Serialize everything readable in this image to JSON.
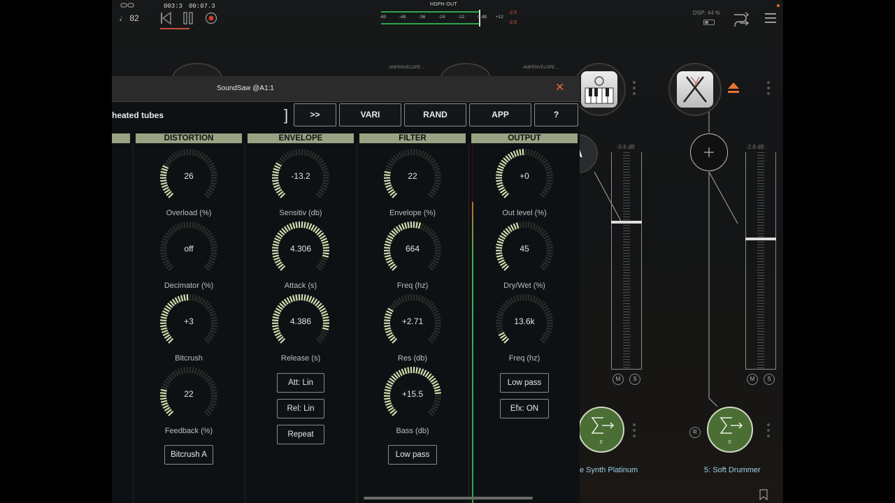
{
  "topbar": {
    "tempo": "♩ 82",
    "bars": "003:3",
    "time": "00:07.3",
    "meter_title": "HDPH OUT",
    "meter_scale": [
      "-60",
      "-48",
      "-36",
      "-24",
      "-12",
      "0 dB",
      "+12"
    ],
    "peak_top": "-2.5",
    "peak_bottom": "-2.6",
    "dsp": "DSP: 44 %"
  },
  "mixer": {
    "amp_env_1": "AMPENVELOPE…",
    "amp_env_2": "AMPENVELOPE…",
    "fader1_db": "-0.6 dB",
    "fader2_db": "-2.8 dB",
    "mute": "M",
    "solo": "S",
    "record": "R",
    "e_label": "E",
    "channel_a_name": "e Synth Platinum",
    "channel_b_name": "5: Soft Drummer",
    "partial_letter": "A"
  },
  "plugin": {
    "title": "SoundSaw @A1:1",
    "close": "✕",
    "preset_name": "heated tubes",
    "bracket": "]",
    "buttons": [
      ">>",
      "VARI",
      "RAND",
      "APP",
      "?"
    ],
    "sections": {
      "distortion": "DISTORTION",
      "envelope": "ENVELOPE",
      "filter": "FILTER",
      "output": "OUTPUT"
    },
    "distortion": {
      "overload": {
        "value": "26",
        "label": "Overload (%)",
        "fill": 0.26
      },
      "decimator": {
        "value": "off",
        "label": "Decimator (%)",
        "fill": 0.0
      },
      "bitcrush": {
        "value": "+3",
        "label": "Bitcrush",
        "fill": 0.5
      },
      "feedback": {
        "value": "22",
        "label": "Feedback (%)",
        "fill": 0.22
      },
      "mode_button": "Bitcrush A"
    },
    "envelope": {
      "sensitivity": {
        "value": "-13.2",
        "label": "Sensitiv (db)",
        "fill": 0.3
      },
      "attack": {
        "value": "4.306",
        "label": "Attack (s)",
        "fill": 0.9
      },
      "release": {
        "value": "4.386",
        "label": "Release (s)",
        "fill": 0.9
      },
      "att_button": "Att: Lin",
      "rel_button": "Rel: Lin",
      "repeat_button": "Repeat"
    },
    "filter": {
      "envelope": {
        "value": "22",
        "label": "Envelope (%)",
        "fill": 0.22
      },
      "freq": {
        "value": "664",
        "label": "Freq (hz)",
        "fill": 0.58
      },
      "res": {
        "value": "+2.71",
        "label": "Res (db)",
        "fill": 0.3
      },
      "bass": {
        "value": "+15.5",
        "label": "Bass (db)",
        "fill": 0.82
      },
      "mode_button": "Low pass"
    },
    "output": {
      "out_level": {
        "value": "+0",
        "label": "Out level (%)",
        "fill": 0.5
      },
      "dry_wet": {
        "value": "45",
        "label": "Dry/Wet (%)",
        "fill": 0.45
      },
      "freq": {
        "value": "13.6k",
        "label": "Freq (hz)",
        "fill": 0.08
      },
      "mode_button": "Low pass",
      "efx_button": "Efx: ON"
    }
  },
  "colors": {
    "knob_fill": "#d2ddb0",
    "knob_track": "#2a2e2b",
    "section_head": "#9aa284",
    "close": "#e66a3a",
    "channel_green": "#4a6e34",
    "channel_name": "#9fd0e8"
  }
}
